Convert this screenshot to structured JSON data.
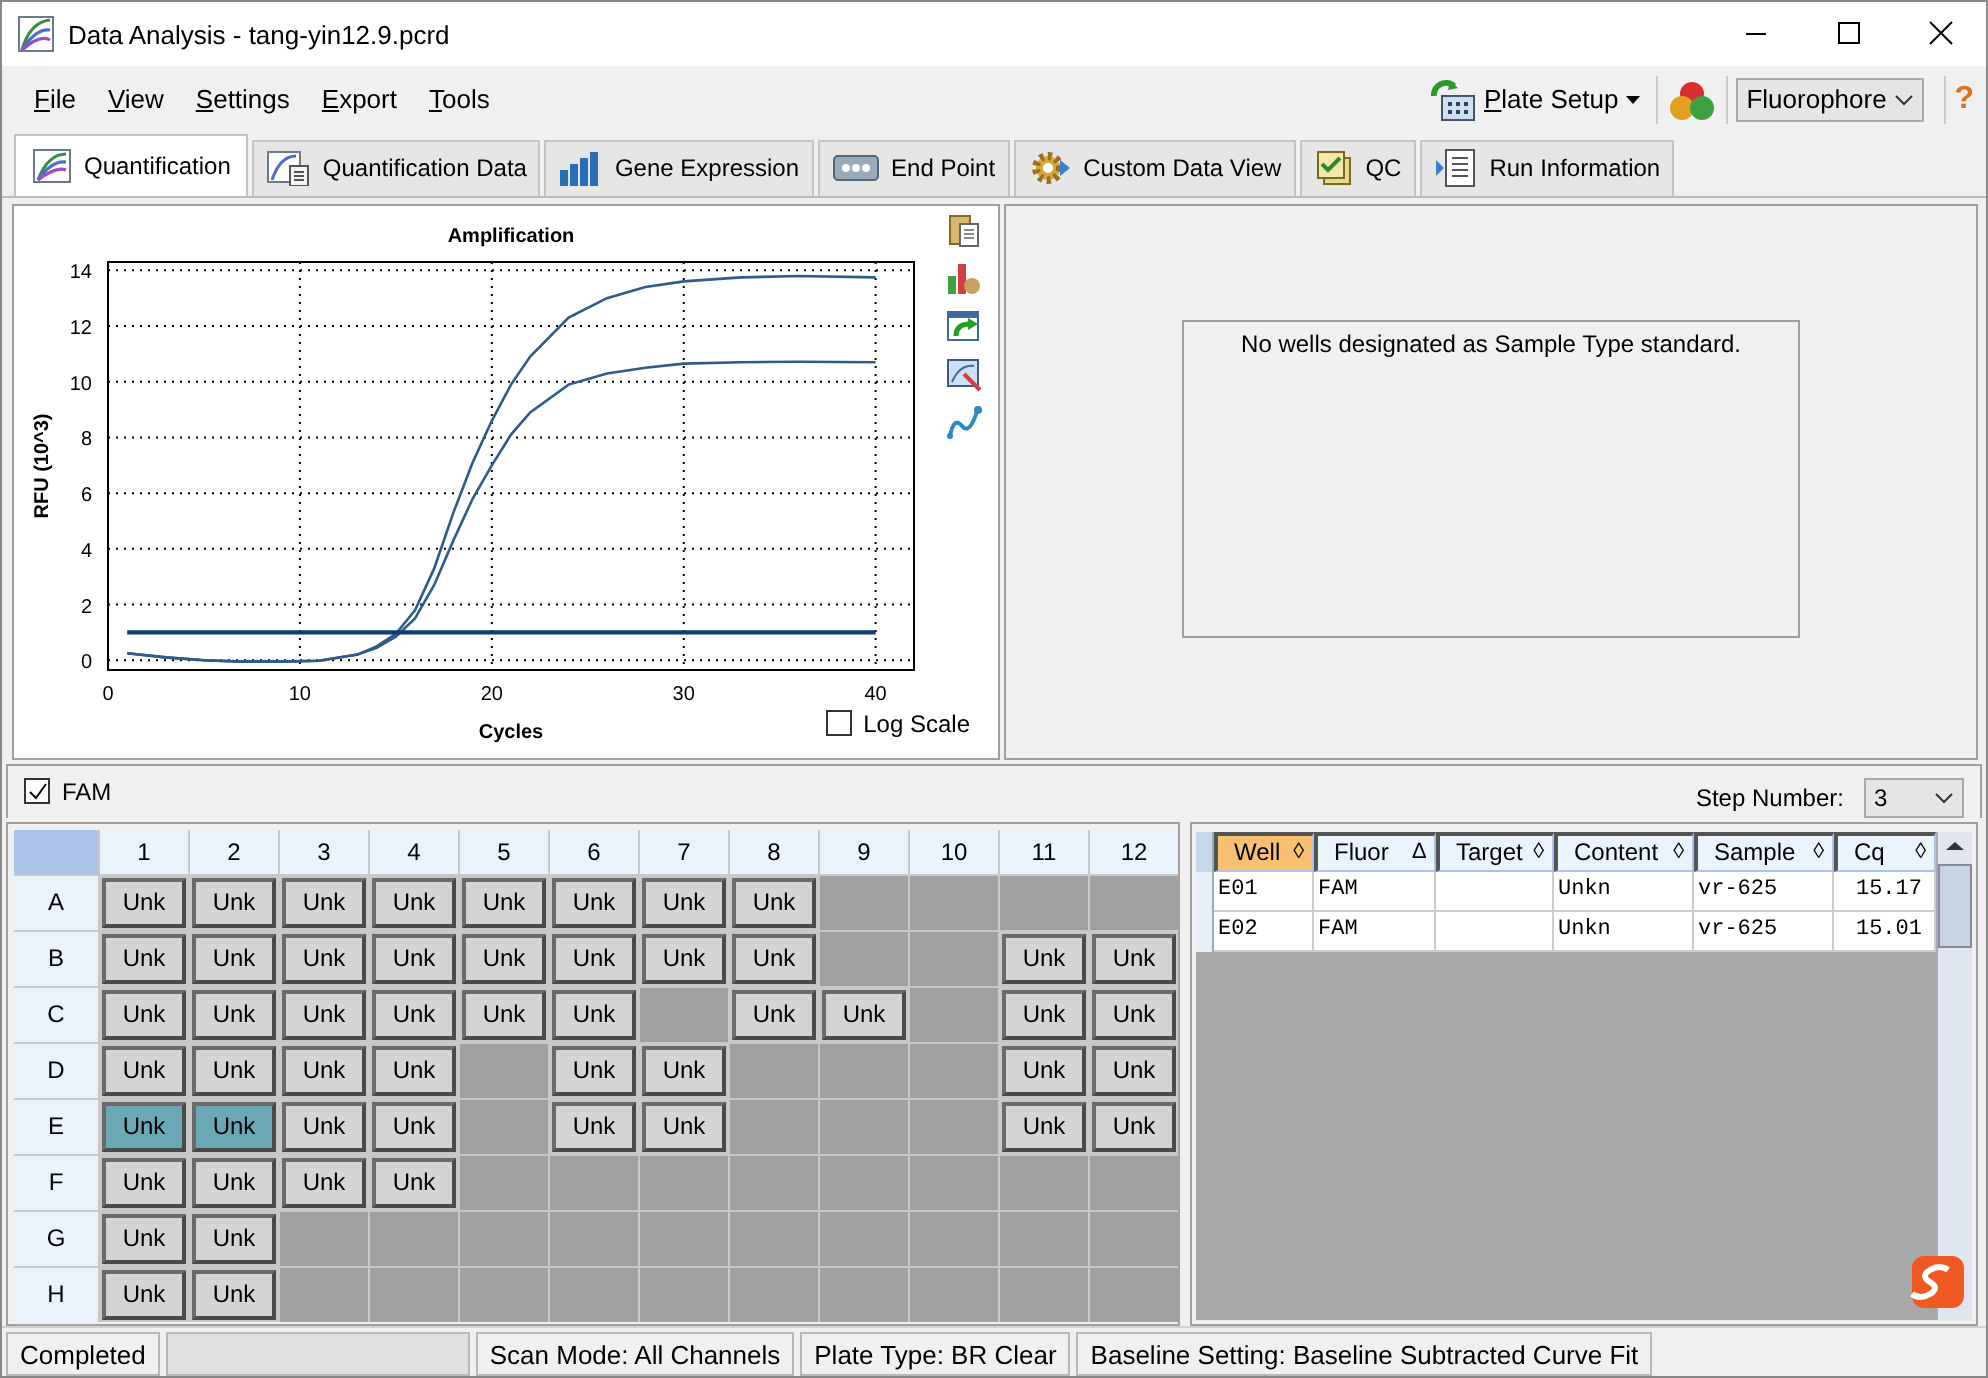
{
  "window": {
    "title": "Data Analysis - tang-yin12.9.pcrd"
  },
  "menu": [
    "File",
    "View",
    "Settings",
    "Export",
    "Tools"
  ],
  "toolbar": {
    "plate_setup": "Plate Setup",
    "fluorophore": "Fluorophore",
    "help": "?"
  },
  "tabs": [
    {
      "label": "Quantification",
      "selected": true
    },
    {
      "label": "Quantification Data",
      "selected": false
    },
    {
      "label": "Gene Expression",
      "selected": false
    },
    {
      "label": "End Point",
      "selected": false
    },
    {
      "label": "Custom Data View",
      "selected": false
    },
    {
      "label": "QC",
      "selected": false
    },
    {
      "label": "Run Information",
      "selected": false
    }
  ],
  "chart_data": {
    "type": "line",
    "title": "Amplification",
    "xlabel": "Cycles",
    "ylabel": "RFU (10^3)",
    "x": [
      1,
      3,
      5,
      7,
      9,
      11,
      13,
      14,
      15,
      16,
      17,
      18,
      19,
      20,
      21,
      22,
      24,
      26,
      28,
      30,
      33,
      36,
      40
    ],
    "series": [
      {
        "color": "#2e5a8c",
        "values": [
          0.25,
          0.1,
          0.0,
          -0.05,
          -0.05,
          -0.02,
          0.2,
          0.5,
          0.95,
          1.8,
          3.3,
          5.3,
          7.1,
          8.6,
          9.9,
          10.9,
          12.3,
          13.0,
          13.4,
          13.6,
          13.75,
          13.8,
          13.75
        ]
      },
      {
        "color": "#2e5a8c",
        "values": [
          0.25,
          0.1,
          0.0,
          -0.05,
          -0.05,
          -0.02,
          0.2,
          0.45,
          0.85,
          1.5,
          2.7,
          4.3,
          5.8,
          7.0,
          8.1,
          8.9,
          9.9,
          10.3,
          10.5,
          10.65,
          10.7,
          10.72,
          10.7
        ]
      },
      {
        "color": "#0d3c78",
        "values": [
          1,
          1,
          1,
          1,
          1,
          1,
          1,
          1,
          1,
          1,
          1,
          1,
          1,
          1,
          1,
          1,
          1,
          1,
          1,
          1,
          1,
          1,
          1
        ]
      }
    ],
    "xlim": [
      0,
      42
    ],
    "ylim": [
      -0.35,
      14.3
    ],
    "xticks": [
      0,
      10,
      20,
      30,
      40
    ],
    "yticks": [
      0,
      2,
      4,
      6,
      8,
      10,
      12,
      14
    ],
    "grid": true
  },
  "log_scale": {
    "label": "Log Scale",
    "checked": false
  },
  "standard_message": "No wells designated as Sample Type standard.",
  "filter": {
    "label": "FAM",
    "checked": true
  },
  "step": {
    "label": "Step Number:",
    "value": "3"
  },
  "plate": {
    "columns": [
      "1",
      "2",
      "3",
      "4",
      "5",
      "6",
      "7",
      "8",
      "9",
      "10",
      "11",
      "12"
    ],
    "rows": [
      {
        "label": "A",
        "wells": [
          {
            "text": "Unk",
            "selected": false
          },
          {
            "text": "Unk",
            "selected": false
          },
          {
            "text": "Unk",
            "selected": false
          },
          {
            "text": "Unk",
            "selected": false
          },
          {
            "text": "Unk",
            "selected": false
          },
          {
            "text": "Unk",
            "selected": false
          },
          {
            "text": "Unk",
            "selected": false
          },
          {
            "text": "Unk",
            "selected": false
          },
          {
            "kind": "empty"
          },
          {
            "kind": "empty"
          },
          {
            "kind": "empty"
          },
          {
            "kind": "empty"
          }
        ]
      },
      {
        "label": "B",
        "wells": [
          {
            "text": "Unk",
            "selected": false
          },
          {
            "text": "Unk",
            "selected": false
          },
          {
            "text": "Unk",
            "selected": false
          },
          {
            "text": "Unk",
            "selected": false
          },
          {
            "text": "Unk",
            "selected": false
          },
          {
            "text": "Unk",
            "selected": false
          },
          {
            "text": "Unk",
            "selected": false
          },
          {
            "text": "Unk",
            "selected": false
          },
          {
            "kind": "empty"
          },
          {
            "kind": "empty"
          },
          {
            "text": "Unk",
            "selected": false
          },
          {
            "text": "Unk",
            "selected": false
          }
        ]
      },
      {
        "label": "C",
        "wells": [
          {
            "text": "Unk",
            "selected": false
          },
          {
            "text": "Unk",
            "selected": false
          },
          {
            "text": "Unk",
            "selected": false
          },
          {
            "text": "Unk",
            "selected": false
          },
          {
            "text": "Unk",
            "selected": false
          },
          {
            "text": "Unk",
            "selected": false
          },
          {
            "kind": "empty"
          },
          {
            "text": "Unk",
            "selected": false
          },
          {
            "text": "Unk",
            "selected": false
          },
          {
            "kind": "empty"
          },
          {
            "text": "Unk",
            "selected": false
          },
          {
            "text": "Unk",
            "selected": false
          }
        ]
      },
      {
        "label": "D",
        "wells": [
          {
            "text": "Unk",
            "selected": false
          },
          {
            "text": "Unk",
            "selected": false
          },
          {
            "text": "Unk",
            "selected": false
          },
          {
            "text": "Unk",
            "selected": false
          },
          {
            "kind": "empty"
          },
          {
            "text": "Unk",
            "selected": false
          },
          {
            "text": "Unk",
            "selected": false
          },
          {
            "kind": "empty"
          },
          {
            "kind": "empty"
          },
          {
            "kind": "empty"
          },
          {
            "text": "Unk",
            "selected": false
          },
          {
            "text": "Unk",
            "selected": false
          }
        ]
      },
      {
        "label": "E",
        "wells": [
          {
            "text": "Unk",
            "selected": true
          },
          {
            "text": "Unk",
            "selected": true
          },
          {
            "text": "Unk",
            "selected": false
          },
          {
            "text": "Unk",
            "selected": false
          },
          {
            "kind": "empty"
          },
          {
            "text": "Unk",
            "selected": false
          },
          {
            "text": "Unk",
            "selected": false
          },
          {
            "kind": "empty"
          },
          {
            "kind": "empty"
          },
          {
            "kind": "empty"
          },
          {
            "text": "Unk",
            "selected": false
          },
          {
            "text": "Unk",
            "selected": false
          }
        ]
      },
      {
        "label": "F",
        "wells": [
          {
            "text": "Unk",
            "selected": false
          },
          {
            "text": "Unk",
            "selected": false
          },
          {
            "text": "Unk",
            "selected": false
          },
          {
            "text": "Unk",
            "selected": false
          },
          {
            "kind": "empty"
          },
          {
            "kind": "empty"
          },
          {
            "kind": "empty"
          },
          {
            "kind": "empty"
          },
          {
            "kind": "empty"
          },
          {
            "kind": "empty"
          },
          {
            "kind": "empty"
          },
          {
            "kind": "empty"
          }
        ]
      },
      {
        "label": "G",
        "wells": [
          {
            "text": "Unk",
            "selected": false
          },
          {
            "text": "Unk",
            "selected": false
          },
          {
            "kind": "empty"
          },
          {
            "kind": "empty"
          },
          {
            "kind": "empty"
          },
          {
            "kind": "empty"
          },
          {
            "kind": "empty"
          },
          {
            "kind": "empty"
          },
          {
            "kind": "empty"
          },
          {
            "kind": "empty"
          },
          {
            "kind": "empty"
          },
          {
            "kind": "empty"
          }
        ]
      },
      {
        "label": "H",
        "wells": [
          {
            "text": "Unk",
            "selected": false
          },
          {
            "text": "Unk",
            "selected": false
          },
          {
            "kind": "empty"
          },
          {
            "kind": "empty"
          },
          {
            "kind": "empty"
          },
          {
            "kind": "empty"
          },
          {
            "kind": "empty"
          },
          {
            "kind": "empty"
          },
          {
            "kind": "empty"
          },
          {
            "kind": "empty"
          },
          {
            "kind": "empty"
          },
          {
            "kind": "empty"
          }
        ]
      }
    ]
  },
  "table": {
    "columns": [
      {
        "label": "Well",
        "sort_mark": "◊",
        "selected": true
      },
      {
        "label": "Fluor",
        "sort_mark": "∆",
        "selected": false
      },
      {
        "label": "Target",
        "sort_mark": "◊",
        "selected": false
      },
      {
        "label": "Content",
        "sort_mark": "◊",
        "selected": false
      },
      {
        "label": "Sample",
        "sort_mark": "◊",
        "selected": false
      },
      {
        "label": "Cq",
        "sort_mark": "◊",
        "selected": false
      }
    ],
    "rows": [
      [
        "E01",
        "FAM",
        "",
        "Unkn",
        "vr-625",
        "15.17"
      ],
      [
        "E02",
        "FAM",
        "",
        "Unkn",
        "vr-625",
        "15.01"
      ]
    ]
  },
  "status": [
    {
      "kind": "text",
      "text": "Completed"
    },
    {
      "kind": "blank"
    },
    {
      "kind": "text",
      "text": "Scan Mode: All Channels"
    },
    {
      "kind": "text",
      "text": "Plate Type: BR Clear"
    },
    {
      "kind": "text",
      "text": "Baseline Setting: Baseline Subtracted Curve Fit"
    }
  ]
}
